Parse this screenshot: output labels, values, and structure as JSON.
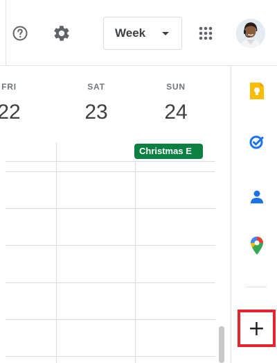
{
  "header": {
    "help_icon": "help-circle-icon",
    "settings_icon": "gear-icon",
    "view_selector": "Week",
    "apps_icon": "apps-grid-icon",
    "avatar_icon": "user-avatar"
  },
  "calendar": {
    "days": [
      {
        "dow": "FRI",
        "date": "22"
      },
      {
        "dow": "SAT",
        "date": "23"
      },
      {
        "dow": "SUN",
        "date": "24"
      }
    ],
    "event": {
      "label": "Christmas E",
      "color": "#0b8043"
    }
  },
  "side_panel": {
    "items": [
      "keep-icon",
      "tasks-icon",
      "contacts-icon",
      "maps-icon"
    ],
    "add_label": "+",
    "highlight_color": "#e5242b"
  }
}
